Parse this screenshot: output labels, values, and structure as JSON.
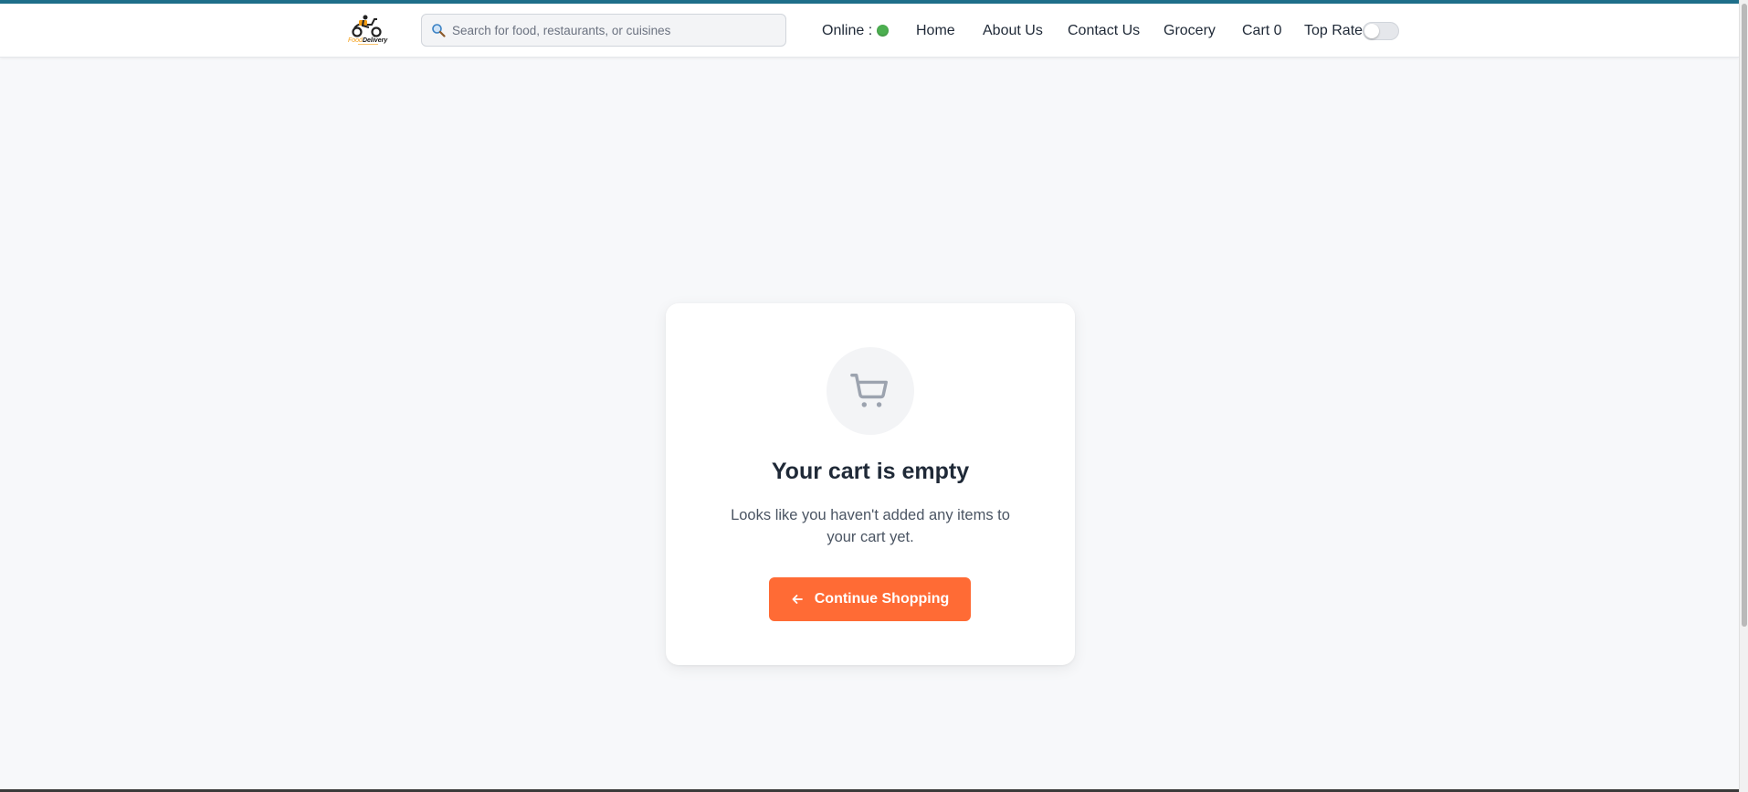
{
  "header": {
    "accent_color": "#1e6f8a",
    "logo_text_part1": "Food",
    "logo_text_part2": "Delivery",
    "search": {
      "placeholder": "Search for food, restaurants, or cuisines",
      "icon": "magnifier-icon"
    },
    "online_label": "Online :",
    "online_status_color": "#4caf50",
    "nav": {
      "home": "Home",
      "about": "About Us",
      "contact": "Contact Us",
      "grocery": "Grocery",
      "cart": "Cart 0"
    },
    "top_rated_label": "Top Rated",
    "top_rated_enabled": false
  },
  "empty_cart": {
    "icon": "shopping-cart-icon",
    "title": "Your cart is empty",
    "message": "Looks like you haven't added any items to your cart yet.",
    "button_label": "Continue Shopping",
    "button_icon": "arrow-left-icon",
    "button_color": "#ff6b35"
  }
}
